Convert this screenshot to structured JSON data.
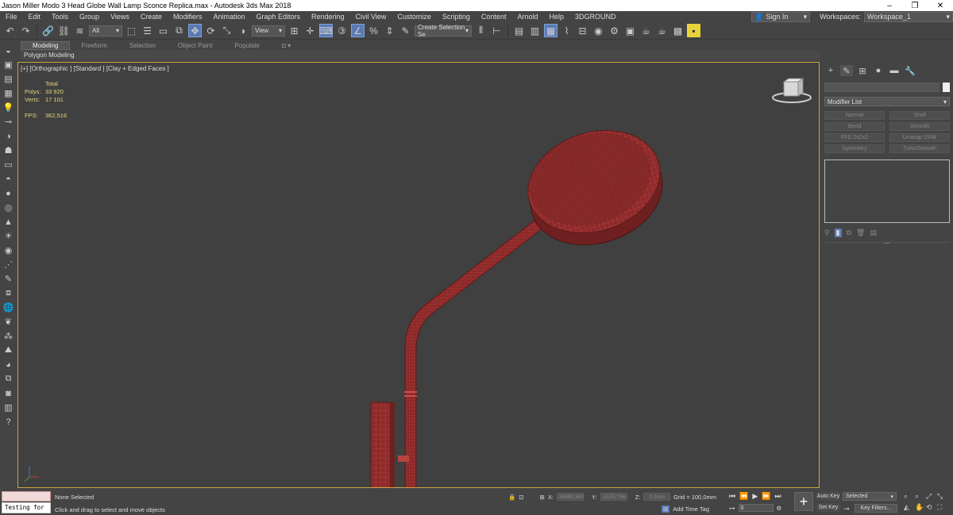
{
  "window": {
    "title": "Jason Miller Modo 3 Head Globe Wall Lamp Sconce Replica.max - Autodesk 3ds Max 2018",
    "min": "–",
    "max": "❐",
    "close": "✕"
  },
  "menu": {
    "items": [
      "File",
      "Edit",
      "Tools",
      "Group",
      "Views",
      "Create",
      "Modifiers",
      "Animation",
      "Graph Editors",
      "Rendering",
      "Civil View",
      "Customize",
      "Scripting",
      "Content",
      "Arnold",
      "Help",
      "3DGROUND"
    ],
    "signin": "Sign In",
    "workspaces_label": "Workspaces:",
    "workspace_value": "Workspace_1"
  },
  "toolbar": {
    "filter_value": "All",
    "refcoord_value": "View",
    "selection_set_value": "Create Selection Se"
  },
  "ribbon": {
    "tabs": [
      "Modeling",
      "Freeform",
      "Selection",
      "Object Paint",
      "Populate"
    ],
    "active_tab": "Modeling",
    "sub_label": "Polygon Modeling"
  },
  "viewport": {
    "label": "[+] [Orthographic ] [Standard ] [Clay + Edged Faces ]",
    "stats_header": "Total",
    "polys_label": "Polys:",
    "polys_value": "33 920",
    "verts_label": "Verts:",
    "verts_value": "17 101",
    "fps_label": "FPS:",
    "fps_value": "362,516",
    "colors": {
      "background": "#404040",
      "model_fill": "#8e2a2a",
      "model_wire": "#c9524e",
      "border": "#c9a63f"
    }
  },
  "command_panel": {
    "modifier_list": "Modifier List",
    "modifier_buttons": [
      "Normal",
      "Shell",
      "Bend",
      "Smooth",
      "FFD 2x2x2",
      "Unwrap UVW",
      "Symmetry",
      "TurboSmooth"
    ]
  },
  "status": {
    "maxscript_line2": "Testing for :",
    "selection": "None Selected",
    "prompt": "Click and drag to select and move objects",
    "x_label": "X:",
    "x_value": "-36888,363",
    "y_label": "Y:",
    "y_value": "-5155,766",
    "z_label": "Z:",
    "z_value": "0,0mm",
    "grid": "Grid = 100,0mm",
    "add_time_tag": "Add Time Tag",
    "frame": "0",
    "auto_key": "Auto Key",
    "set_key": "Set Key",
    "selected_drop": "Selected",
    "key_filters": "Key Filters..."
  }
}
